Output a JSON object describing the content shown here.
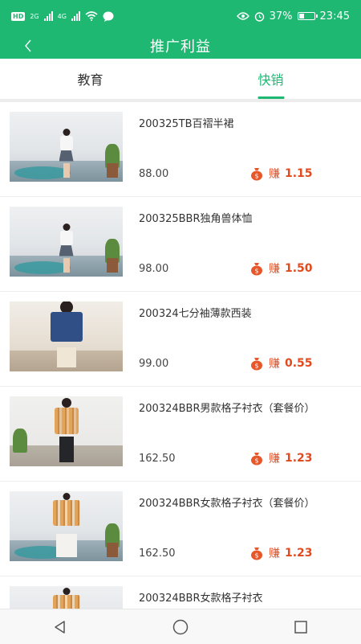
{
  "status_bar": {
    "hd_label": "HD",
    "sim1_label": "2G",
    "sim2_label": "4G",
    "battery_percent": "37%",
    "battery_level": 0.37,
    "time": "23:45",
    "icons": [
      "hd-icon",
      "signal-icon",
      "signal-icon",
      "wifi-icon",
      "chat-icon",
      "eye-icon",
      "alarm-icon",
      "battery-icon"
    ]
  },
  "nav": {
    "back_icon": "back-chevron-icon",
    "title": "推广利益"
  },
  "tabs": [
    {
      "label": "教育",
      "active": false
    },
    {
      "label": "快销",
      "active": true
    }
  ],
  "colors": {
    "brand_green": "#1fb873",
    "earn_red": "#e24a1e"
  },
  "products": [
    {
      "name": "200325TB百褶半裙",
      "price": "88.00",
      "earn_label": "赚",
      "earn_value": "1.15"
    },
    {
      "name": "200325BBR独角兽体恤",
      "price": "98.00",
      "earn_label": "赚",
      "earn_value": "1.50"
    },
    {
      "name": "200324七分袖薄款西装",
      "price": "99.00",
      "earn_label": "赚",
      "earn_value": "0.55"
    },
    {
      "name": "200324BBR男款格子衬衣（套餐价）",
      "price": "162.50",
      "earn_label": "赚",
      "earn_value": "1.23"
    },
    {
      "name": "200324BBR女款格子衬衣（套餐价）",
      "price": "162.50",
      "earn_label": "赚",
      "earn_value": "1.23"
    },
    {
      "name": "200324BBR女款格子衬衣",
      "price": "",
      "earn_label": "",
      "earn_value": ""
    }
  ],
  "system_nav": {
    "icons": [
      "back-triangle-icon",
      "home-circle-icon",
      "recents-square-icon"
    ]
  }
}
